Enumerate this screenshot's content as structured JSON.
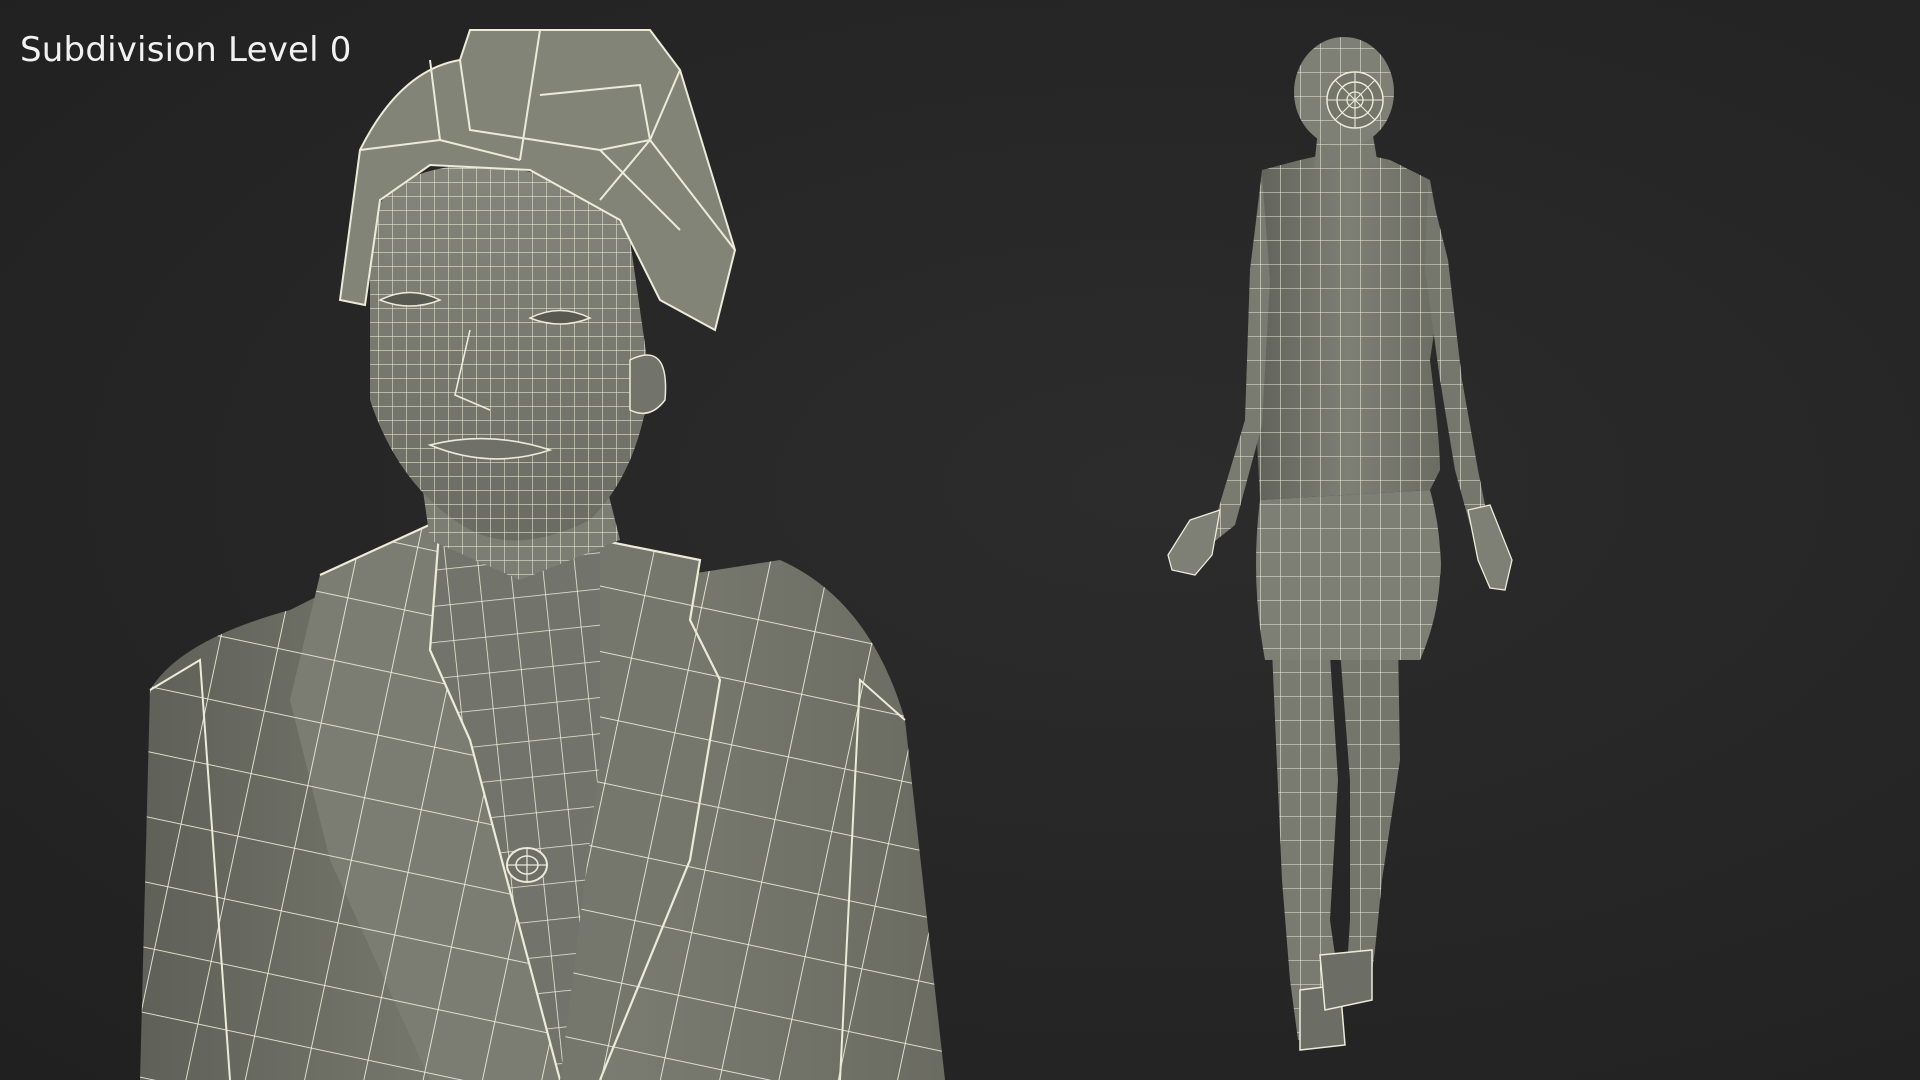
{
  "caption": "Subdivision Level 0",
  "colors": {
    "background": "#262626",
    "mesh_fill": "#7a7b70",
    "mesh_shadow": "#5d5e55",
    "wire": "#ecebd8"
  },
  "views": [
    {
      "name": "front-closeup",
      "subject": "female figure in suit and hat, head and torso"
    },
    {
      "name": "back-full-body",
      "subject": "female figure in suit and hat, full body from behind"
    }
  ]
}
